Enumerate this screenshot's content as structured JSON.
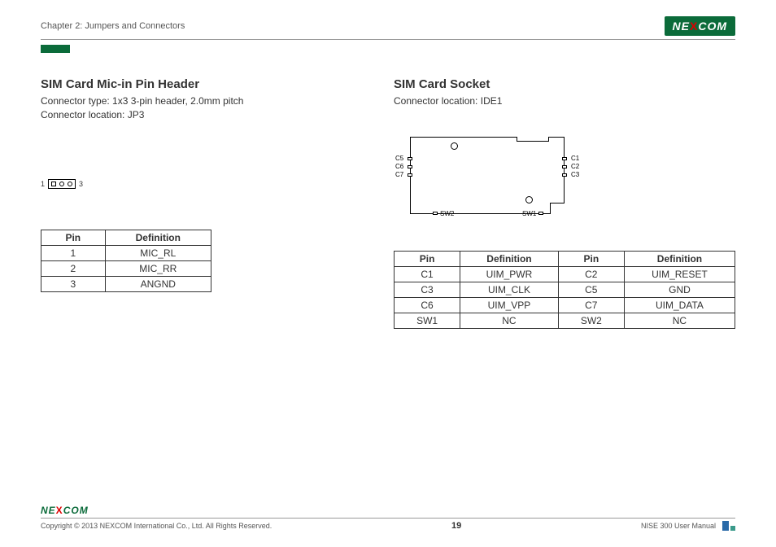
{
  "header": {
    "chapter": "Chapter 2: Jumpers and Connectors",
    "logo_pre": "NE",
    "logo_x": "X",
    "logo_post": "COM"
  },
  "left": {
    "title": "SIM Card Mic-in Pin Header",
    "sub1": "Connector type: 1x3 3-pin header, 2.0mm pitch",
    "sub2": "Connector location: JP3",
    "diagram": {
      "left_label": "1",
      "right_label": "3"
    },
    "table": {
      "headers": {
        "pin": "Pin",
        "def": "Definition"
      },
      "rows": [
        {
          "pin": "1",
          "def": "MIC_RL"
        },
        {
          "pin": "2",
          "def": "MIC_RR"
        },
        {
          "pin": "3",
          "def": "ANGND"
        }
      ]
    }
  },
  "right": {
    "title": "SIM Card Socket",
    "sub1": "Connector location: IDE1",
    "diagram_labels": {
      "c5": "C5",
      "c6": "C6",
      "c7": "C7",
      "c1": "C1",
      "c2": "C2",
      "c3": "C3",
      "sw1": "SW1",
      "sw2": "SW2"
    },
    "table": {
      "headers": {
        "pin": "Pin",
        "def": "Definition",
        "pin2": "Pin",
        "def2": "Definition"
      },
      "rows": [
        {
          "p1": "C1",
          "d1": "UIM_PWR",
          "p2": "C2",
          "d2": "UIM_RESET"
        },
        {
          "p1": "C3",
          "d1": "UIM_CLK",
          "p2": "C5",
          "d2": "GND"
        },
        {
          "p1": "C6",
          "d1": "UIM_VPP",
          "p2": "C7",
          "d2": "UIM_DATA"
        },
        {
          "p1": "SW1",
          "d1": "NC",
          "p2": "SW2",
          "d2": "NC"
        }
      ]
    }
  },
  "footer": {
    "copyright": "Copyright © 2013 NEXCOM International Co., Ltd. All Rights Reserved.",
    "page": "19",
    "manual": "NISE 300 User Manual",
    "logo_pre": "NE",
    "logo_x": "X",
    "logo_post": "COM"
  }
}
